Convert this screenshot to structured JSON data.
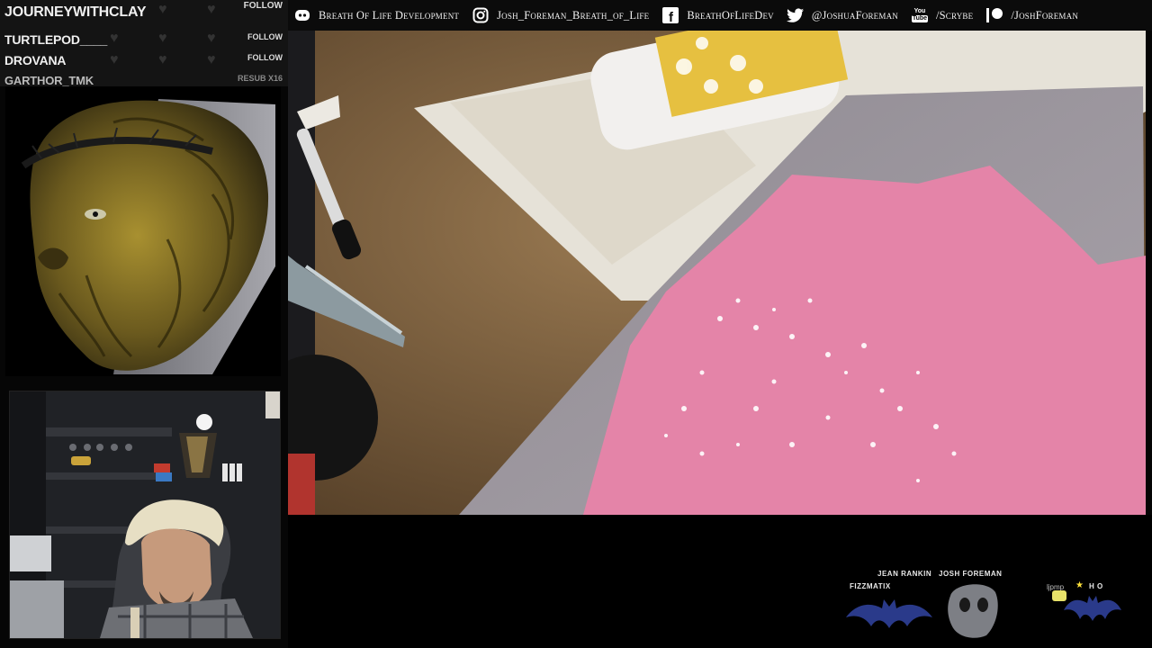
{
  "social_bar": [
    {
      "icon": "discord-icon",
      "text": "Breath Of Life Development"
    },
    {
      "icon": "instagram-icon",
      "text": "Josh_Foreman_Breath_of_Life"
    },
    {
      "icon": "facebook-icon",
      "text": "BreathOfLifeDev"
    },
    {
      "icon": "twitter-icon",
      "text": "@JoshuaForeman"
    },
    {
      "icon": "youtube-icon",
      "text": "/Scrybe"
    },
    {
      "icon": "patreon-icon",
      "text": "/JoshForeman"
    }
  ],
  "followers": [
    {
      "name": "JOURNEYWITHCLAY",
      "action": "FOLLOW"
    },
    {
      "name": "TURTLEPOD____",
      "action": "FOLLOW"
    },
    {
      "name": "DROVANA",
      "action": "FOLLOW"
    },
    {
      "name": "GARTHOR_TMK",
      "action": "RESUB X16"
    }
  ],
  "subscribers": {
    "row1": [
      "JEAN RANKIN",
      "JOSH FOREMAN"
    ],
    "row2_left": "FIZZMATIX",
    "row2_right": "H O",
    "tag": "ljpmp"
  },
  "colors": {
    "pink_mold": "#e484a8",
    "foam_gray": "#9a949a",
    "table_brown": "#7a5c3a",
    "bar_bg": "#0b0b0b",
    "panel_bg": "#141414"
  }
}
